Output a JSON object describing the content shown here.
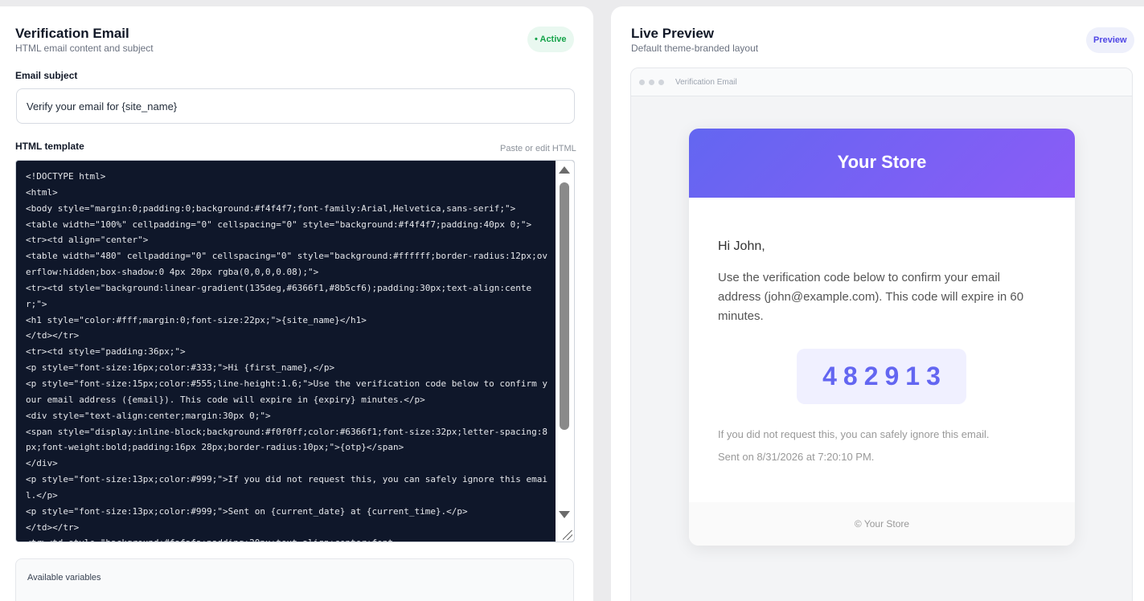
{
  "editor": {
    "title": "Verification Email",
    "subtitle": "HTML email content and subject",
    "status_badge": "• Active",
    "subject_label": "Email subject",
    "subject_value": "Verify your email for {site_name}",
    "template_label": "HTML template",
    "template_hint": "Paste or edit HTML",
    "template_code": "<!DOCTYPE html>\n<html>\n<body style=\"margin:0;padding:0;background:#f4f4f7;font-family:Arial,Helvetica,sans-serif;\">\n<table width=\"100%\" cellpadding=\"0\" cellspacing=\"0\" style=\"background:#f4f4f7;padding:40px 0;\">\n<tr><td align=\"center\">\n<table width=\"480\" cellpadding=\"0\" cellspacing=\"0\" style=\"background:#ffffff;border-radius:12px;overflow:hidden;box-shadow:0 4px 20px rgba(0,0,0,0.08);\">\n<tr><td style=\"background:linear-gradient(135deg,#6366f1,#8b5cf6);padding:30px;text-align:center;\">\n<h1 style=\"color:#fff;margin:0;font-size:22px;\">{site_name}</h1>\n</td></tr>\n<tr><td style=\"padding:36px;\">\n<p style=\"font-size:16px;color:#333;\">Hi {first_name},</p>\n<p style=\"font-size:15px;color:#555;line-height:1.6;\">Use the verification code below to confirm your email address ({email}). This code will expire in {expiry} minutes.</p>\n<div style=\"text-align:center;margin:30px 0;\">\n<span style=\"display:inline-block;background:#f0f0ff;color:#6366f1;font-size:32px;letter-spacing:8px;font-weight:bold;padding:16px 28px;border-radius:10px;\">{otp}</span>\n</div>\n<p style=\"font-size:13px;color:#999;\">If you did not request this, you can safely ignore this email.</p>\n<p style=\"font-size:13px;color:#999;\">Sent on {current_date} at {current_time}.</p>\n</td></tr>\n<tr><td style=\"background:#fafafa;padding:20px;text-align:center;font-",
    "variables_title": "Available variables"
  },
  "preview": {
    "title": "Live Preview",
    "subtitle": "Default theme-branded layout",
    "badge": "Preview",
    "browser_title": "Verification Email",
    "email": {
      "store_name": "Your Store",
      "greeting": "Hi John,",
      "body": "Use the verification code below to confirm your email address (john@example.com). This code will expire in 60 minutes.",
      "otp": "482913",
      "ignore_note": "If you did not request this, you can safely ignore this email.",
      "sent_note": "Sent on 8/31/2026 at 7:20:10 PM.",
      "footer": "© Your Store"
    }
  },
  "colors": {
    "accent": "#6366f1",
    "accent_2": "#8b5cf6",
    "active_green": "#16a34a",
    "code_bg": "#0f172a"
  }
}
